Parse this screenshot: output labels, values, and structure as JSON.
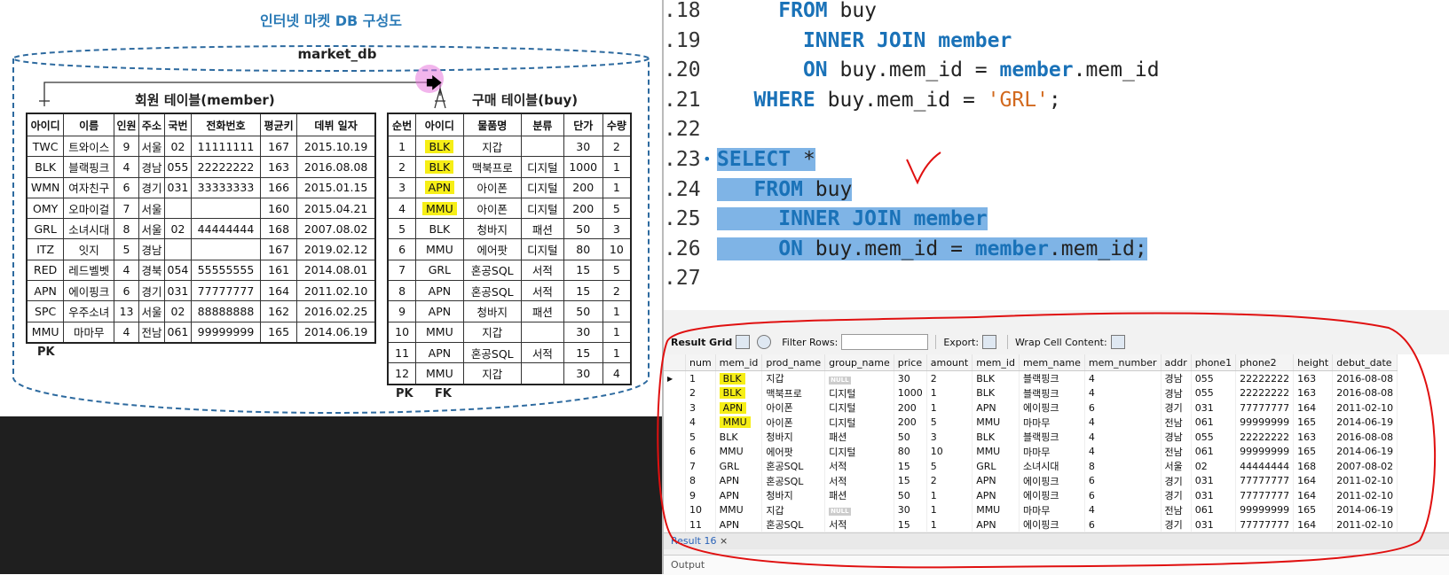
{
  "figure": {
    "title": "인터넷 마켓 DB 구성도",
    "db_name": "market_db",
    "member_table": {
      "title": "회원 테이블(member)",
      "headers": [
        "아이디",
        "이름",
        "인원",
        "주소",
        "국번",
        "전화번호",
        "평균키",
        "데뷔 일자"
      ],
      "rows": [
        [
          "TWC",
          "트와이스",
          "9",
          "서울",
          "02",
          "11111111",
          "167",
          "2015.10.19"
        ],
        [
          "BLK",
          "블랙핑크",
          "4",
          "경남",
          "055",
          "22222222",
          "163",
          "2016.08.08"
        ],
        [
          "WMN",
          "여자친구",
          "6",
          "경기",
          "031",
          "33333333",
          "166",
          "2015.01.15"
        ],
        [
          "OMY",
          "오마이걸",
          "7",
          "서울",
          "",
          "",
          "160",
          "2015.04.21"
        ],
        [
          "GRL",
          "소녀시대",
          "8",
          "서울",
          "02",
          "44444444",
          "168",
          "2007.08.02"
        ],
        [
          "ITZ",
          "잇지",
          "5",
          "경남",
          "",
          "",
          "167",
          "2019.02.12"
        ],
        [
          "RED",
          "레드벨벳",
          "4",
          "경북",
          "054",
          "55555555",
          "161",
          "2014.08.01"
        ],
        [
          "APN",
          "에이핑크",
          "6",
          "경기",
          "031",
          "77777777",
          "164",
          "2011.02.10"
        ],
        [
          "SPC",
          "우주소녀",
          "13",
          "서울",
          "02",
          "88888888",
          "162",
          "2016.02.25"
        ],
        [
          "MMU",
          "마마무",
          "4",
          "전남",
          "061",
          "99999999",
          "165",
          "2014.06.19"
        ]
      ],
      "pk_label": "PK"
    },
    "buy_table": {
      "title": "구매 테이블(buy)",
      "headers": [
        "순번",
        "아이디",
        "물품명",
        "분류",
        "단가",
        "수량"
      ],
      "rows": [
        [
          "1",
          "BLK",
          "지갑",
          "",
          "30",
          "2"
        ],
        [
          "2",
          "BLK",
          "맥북프로",
          "디지털",
          "1000",
          "1"
        ],
        [
          "3",
          "APN",
          "아이폰",
          "디지털",
          "200",
          "1"
        ],
        [
          "4",
          "MMU",
          "아이폰",
          "디지털",
          "200",
          "5"
        ],
        [
          "5",
          "BLK",
          "청바지",
          "패션",
          "50",
          "3"
        ],
        [
          "6",
          "MMU",
          "에어팟",
          "디지털",
          "80",
          "10"
        ],
        [
          "7",
          "GRL",
          "혼공SQL",
          "서적",
          "15",
          "5"
        ],
        [
          "8",
          "APN",
          "혼공SQL",
          "서적",
          "15",
          "2"
        ],
        [
          "9",
          "APN",
          "청바지",
          "패션",
          "50",
          "1"
        ],
        [
          "10",
          "MMU",
          "지갑",
          "",
          "30",
          "1"
        ],
        [
          "11",
          "APN",
          "혼공SQL",
          "서적",
          "15",
          "1"
        ],
        [
          "12",
          "MMU",
          "지갑",
          "",
          "30",
          "4"
        ]
      ],
      "pk_label": "PK",
      "fk_label": "FK"
    }
  },
  "editor": {
    "lines": [
      {
        "num": "18",
        "tokens": [
          {
            "t": "     "
          },
          {
            "t": "FROM",
            "c": "kw"
          },
          {
            "t": " buy"
          }
        ]
      },
      {
        "num": "19",
        "tokens": [
          {
            "t": "       "
          },
          {
            "t": "INNER JOIN member",
            "c": "kw"
          }
        ]
      },
      {
        "num": "20",
        "tokens": [
          {
            "t": "       "
          },
          {
            "t": "ON",
            "c": "kw"
          },
          {
            "t": " buy.mem_id = "
          },
          {
            "t": "member",
            "c": "kw"
          },
          {
            "t": ".mem_id"
          }
        ]
      },
      {
        "num": "21",
        "tokens": [
          {
            "t": "   "
          },
          {
            "t": "WHERE",
            "c": "kw"
          },
          {
            "t": " buy.mem_id = "
          },
          {
            "t": "'GRL'",
            "c": "str"
          },
          {
            "t": ";"
          }
        ]
      },
      {
        "num": "22",
        "tokens": []
      },
      {
        "num": "23",
        "tokens": [
          {
            "t": "SELECT",
            "c": "kw"
          },
          {
            "t": " *"
          }
        ],
        "selected": true,
        "marker": true
      },
      {
        "num": "24",
        "tokens": [
          {
            "t": "   "
          },
          {
            "t": "FROM",
            "c": "kw"
          },
          {
            "t": " buy"
          }
        ],
        "selected": true
      },
      {
        "num": "25",
        "tokens": [
          {
            "t": "     "
          },
          {
            "t": "INNER JOIN member",
            "c": "kw"
          }
        ],
        "selected": true
      },
      {
        "num": "26",
        "tokens": [
          {
            "t": "     "
          },
          {
            "t": "ON",
            "c": "kw"
          },
          {
            "t": " buy.mem_id = "
          },
          {
            "t": "member",
            "c": "kw"
          },
          {
            "t": ".mem_id;"
          }
        ],
        "selected": true
      },
      {
        "num": "27",
        "tokens": []
      }
    ]
  },
  "results": {
    "toolbar": {
      "result_grid": "Result Grid",
      "filter_rows": "Filter Rows:",
      "export": "Export:",
      "wrap_cell": "Wrap Cell Content:"
    },
    "columns": [
      "num",
      "mem_id",
      "prod_name",
      "group_name",
      "price",
      "amount",
      "mem_id",
      "mem_name",
      "mem_number",
      "addr",
      "phone1",
      "phone2",
      "height",
      "debut_date"
    ],
    "rows": [
      [
        "1",
        "BLK",
        "지갑",
        "NULL",
        "30",
        "2",
        "BLK",
        "블랙핑크",
        "4",
        "경남",
        "055",
        "22222222",
        "163",
        "2016-08-08"
      ],
      [
        "2",
        "BLK",
        "맥북프로",
        "디지털",
        "1000",
        "1",
        "BLK",
        "블랙핑크",
        "4",
        "경남",
        "055",
        "22222222",
        "163",
        "2016-08-08"
      ],
      [
        "3",
        "APN",
        "아이폰",
        "디지털",
        "200",
        "1",
        "APN",
        "에이핑크",
        "6",
        "경기",
        "031",
        "77777777",
        "164",
        "2011-02-10"
      ],
      [
        "4",
        "MMU",
        "아이폰",
        "디지털",
        "200",
        "5",
        "MMU",
        "마마무",
        "4",
        "전남",
        "061",
        "99999999",
        "165",
        "2014-06-19"
      ],
      [
        "5",
        "BLK",
        "청바지",
        "패션",
        "50",
        "3",
        "BLK",
        "블랙핑크",
        "4",
        "경남",
        "055",
        "22222222",
        "163",
        "2016-08-08"
      ],
      [
        "6",
        "MMU",
        "에어팟",
        "디지털",
        "80",
        "10",
        "MMU",
        "마마무",
        "4",
        "전남",
        "061",
        "99999999",
        "165",
        "2014-06-19"
      ],
      [
        "7",
        "GRL",
        "혼공SQL",
        "서적",
        "15",
        "5",
        "GRL",
        "소녀시대",
        "8",
        "서울",
        "02",
        "44444444",
        "168",
        "2007-08-02"
      ],
      [
        "8",
        "APN",
        "혼공SQL",
        "서적",
        "15",
        "2",
        "APN",
        "에이핑크",
        "6",
        "경기",
        "031",
        "77777777",
        "164",
        "2011-02-10"
      ],
      [
        "9",
        "APN",
        "청바지",
        "패션",
        "50",
        "1",
        "APN",
        "에이핑크",
        "6",
        "경기",
        "031",
        "77777777",
        "164",
        "2011-02-10"
      ],
      [
        "10",
        "MMU",
        "지갑",
        "NULL",
        "30",
        "1",
        "MMU",
        "마마무",
        "4",
        "전남",
        "061",
        "99999999",
        "165",
        "2014-06-19"
      ],
      [
        "11",
        "APN",
        "혼공SQL",
        "서적",
        "15",
        "1",
        "APN",
        "에이핑크",
        "6",
        "경기",
        "031",
        "77777777",
        "164",
        "2011-02-10"
      ]
    ],
    "result_tab": "Result 16",
    "close_glyph": "×",
    "output_label": "Output"
  },
  "colors": {
    "keyword": "#1a72b8",
    "selection": "#7fb4e6",
    "highlight": "#f6ee16",
    "annotation": "#e01010"
  }
}
